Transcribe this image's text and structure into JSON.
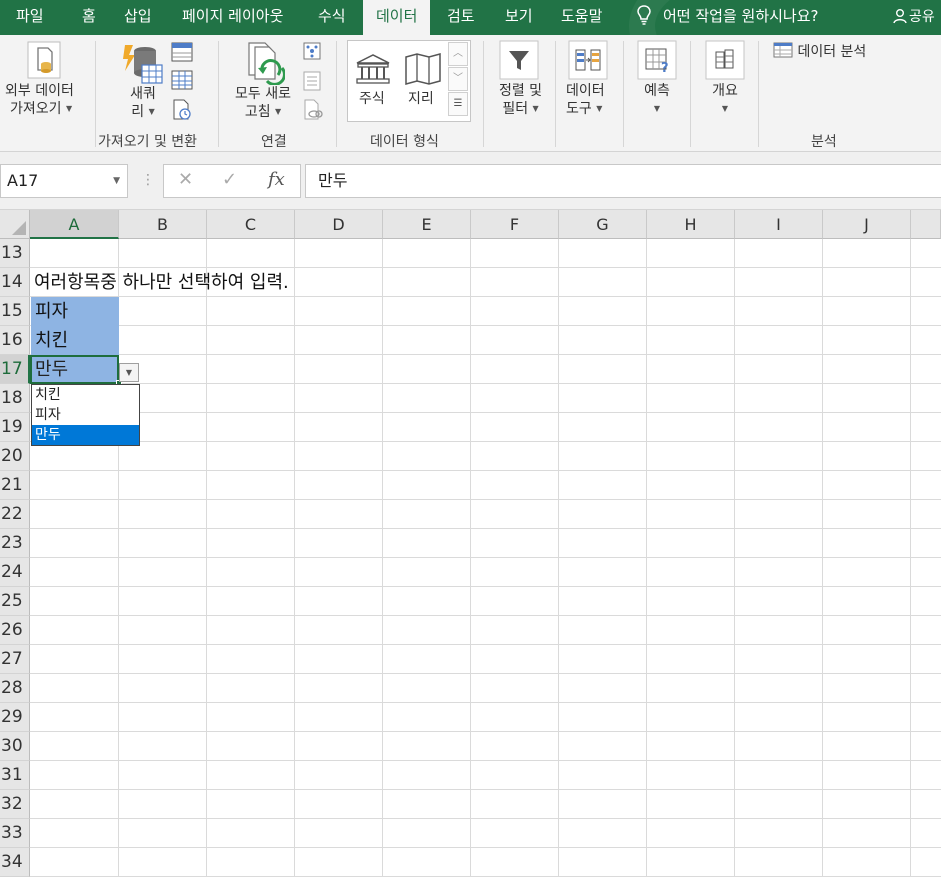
{
  "tabs": [
    "파일",
    "홈",
    "삽입",
    "페이지 레이아웃",
    "수식",
    "데이터",
    "검토",
    "보기",
    "도움말"
  ],
  "active_tab": "데이터",
  "tell_me": "어떤 작업을 원하시나요?",
  "share": "공유",
  "ribbon": {
    "get_external": [
      "외부 데이터",
      "가져오기"
    ],
    "new_query": [
      "새쿼",
      "리"
    ],
    "refresh_all": [
      "모두 새로",
      "고침"
    ],
    "stocks": "주식",
    "geography": "지리",
    "sort_filter": [
      "정렬 및",
      "필터"
    ],
    "data_tools": [
      "데이터",
      "도구"
    ],
    "forecast": "예측",
    "outline": "개요",
    "data_analysis": "데이터 분석",
    "groups": {
      "get_transform": "가져오기 및 변환",
      "connections": "연결",
      "data_types": "데이터 형식",
      "analysis": "분석"
    }
  },
  "formula_bar": {
    "name_box": "A17",
    "formula": "만두"
  },
  "sheet": {
    "columns": [
      "A",
      "B",
      "C",
      "D",
      "E",
      "F",
      "G",
      "H",
      "I",
      "J"
    ],
    "rows": [
      "13",
      "14",
      "15",
      "16",
      "17",
      "18",
      "19",
      "20",
      "21",
      "22",
      "23",
      "24",
      "25",
      "26",
      "27",
      "28",
      "29",
      "30",
      "31",
      "32",
      "33",
      "34"
    ],
    "cell_a14": "여러항목중 하나만 선택하여 입력.",
    "cell_a15": "피자",
    "cell_a16": "치킨",
    "cell_a17": "만두",
    "dropdown_options": [
      "치킨",
      "피자",
      "만두"
    ],
    "dropdown_selected": "만두",
    "colors": {
      "selection_fill": "#8eb4e3",
      "accent": "#217346",
      "highlight": "#0078d7"
    }
  }
}
